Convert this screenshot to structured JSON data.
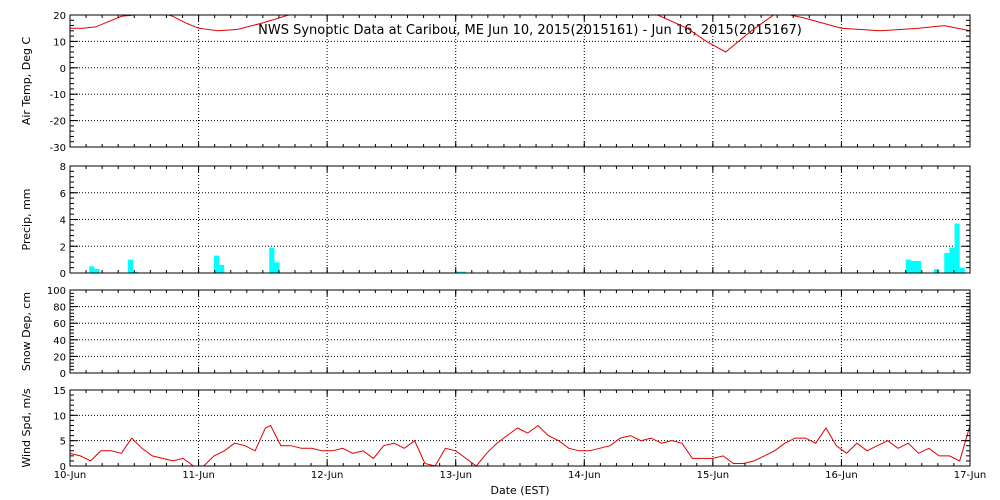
{
  "chart_data": {
    "type": "line",
    "title": "NWS Synoptic Data at Caribou, ME  Jun 10, 2015(2015161) - Jun 16, 2015(2015167)",
    "xlabel": "Date (EST)",
    "x_ticks": [
      "10-Jun",
      "11-Jun",
      "12-Jun",
      "13-Jun",
      "14-Jun",
      "15-Jun",
      "16-Jun",
      "17-Jun"
    ],
    "xlim": [
      0,
      7
    ],
    "grid": true,
    "line_color": "#e00000",
    "bar_color": "#00ffff",
    "panels": [
      {
        "name": "air-temp",
        "type": "line",
        "ylabel": "Air Temp, Deg C",
        "ylim": [
          -30,
          20
        ],
        "yticks": [
          -30,
          -20,
          -10,
          0,
          10,
          20
        ],
        "x": [
          0,
          0.1,
          0.2,
          0.3,
          0.4,
          0.5,
          0.6,
          0.7,
          0.8,
          0.9,
          1.0,
          1.15,
          1.3,
          1.5,
          1.7,
          1.9,
          2.1,
          2.3,
          2.5,
          2.8,
          3.0,
          3.3,
          3.6,
          3.9,
          4.2,
          4.5,
          4.8,
          4.95,
          5.1,
          5.3,
          5.5,
          5.7,
          6.0,
          6.3,
          6.6,
          6.8,
          7.0
        ],
        "y": [
          15.0,
          15.0,
          15.5,
          17.5,
          19.5,
          20.0,
          20.5,
          21.0,
          19.5,
          17.0,
          15.0,
          14.0,
          14.5,
          17.0,
          20.0,
          21.0,
          21.5,
          22.0,
          21.5,
          22.0,
          22.5,
          23.0,
          24.0,
          25.0,
          23.0,
          21.5,
          15.0,
          10.0,
          6.0,
          14.0,
          21.0,
          19.0,
          15.0,
          14.0,
          15.0,
          16.0,
          14.0
        ]
      },
      {
        "name": "precip",
        "type": "bar",
        "ylabel": "Precip, mm",
        "ylim": [
          0,
          8
        ],
        "yticks": [
          0,
          2,
          4,
          6,
          8
        ],
        "bar_width": 0.04,
        "x": [
          0.15,
          0.19,
          0.45,
          0.49,
          1.12,
          1.16,
          1.55,
          1.59,
          3.0,
          3.04,
          6.5,
          6.54,
          6.58,
          6.72,
          6.8,
          6.84,
          6.88,
          6.92
        ],
        "values": [
          0.5,
          0.3,
          1.0,
          0.1,
          1.3,
          0.6,
          1.9,
          0.8,
          0.1,
          0.1,
          1.0,
          0.9,
          0.9,
          0.3,
          1.5,
          1.9,
          3.7,
          0.4
        ]
      },
      {
        "name": "snow-depth",
        "type": "line",
        "ylabel": "Snow Dep, cm",
        "ylim": [
          0,
          100
        ],
        "yticks": [
          0,
          20,
          40,
          60,
          80,
          100
        ],
        "x": [],
        "y": []
      },
      {
        "name": "wind-speed",
        "type": "line",
        "ylabel": "Wind Spd, m/s",
        "ylim": [
          0,
          15
        ],
        "yticks": [
          0,
          5,
          10,
          15
        ],
        "x": [
          0,
          0.08,
          0.16,
          0.24,
          0.32,
          0.4,
          0.48,
          0.56,
          0.64,
          0.72,
          0.8,
          0.88,
          0.96,
          1.04,
          1.12,
          1.2,
          1.28,
          1.36,
          1.44,
          1.52,
          1.56,
          1.6,
          1.64,
          1.72,
          1.8,
          1.88,
          1.96,
          2.04,
          2.12,
          2.2,
          2.28,
          2.36,
          2.44,
          2.52,
          2.6,
          2.68,
          2.76,
          2.84,
          2.92,
          3.0,
          3.08,
          3.16,
          3.24,
          3.32,
          3.4,
          3.48,
          3.56,
          3.64,
          3.72,
          3.8,
          3.88,
          3.96,
          4.04,
          4.12,
          4.2,
          4.28,
          4.36,
          4.44,
          4.52,
          4.6,
          4.68,
          4.76,
          4.84,
          4.92,
          5.0,
          5.08,
          5.16,
          5.24,
          5.32,
          5.4,
          5.48,
          5.56,
          5.64,
          5.72,
          5.8,
          5.88,
          5.96,
          6.04,
          6.12,
          6.2,
          6.28,
          6.36,
          6.44,
          6.52,
          6.6,
          6.68,
          6.76,
          6.84,
          6.92,
          7.0
        ],
        "y": [
          2.5,
          2.0,
          1.0,
          3.0,
          3.0,
          2.5,
          5.5,
          3.5,
          2.0,
          1.5,
          1.0,
          1.5,
          0.0,
          0.0,
          2.0,
          3.0,
          4.5,
          4.0,
          3.0,
          7.5,
          8.0,
          6.0,
          4.0,
          4.0,
          3.5,
          3.5,
          3.0,
          3.0,
          3.5,
          2.5,
          3.0,
          1.5,
          4.0,
          4.5,
          3.5,
          5.0,
          0.5,
          0.0,
          3.5,
          3.0,
          1.5,
          0.0,
          2.5,
          4.5,
          6.0,
          7.5,
          6.5,
          8.0,
          6.0,
          5.0,
          3.5,
          3.0,
          3.0,
          3.5,
          4.0,
          5.5,
          6.0,
          5.0,
          5.5,
          4.5,
          5.0,
          4.5,
          1.5,
          1.5,
          1.5,
          2.0,
          0.5,
          0.5,
          1.0,
          2.0,
          3.0,
          4.5,
          5.5,
          5.5,
          4.5,
          7.5,
          4.0,
          2.5,
          4.5,
          3.0,
          4.0,
          5.0,
          3.5,
          4.5,
          2.5,
          3.5,
          2.0,
          2.0,
          1.0,
          8.0
        ]
      }
    ]
  }
}
